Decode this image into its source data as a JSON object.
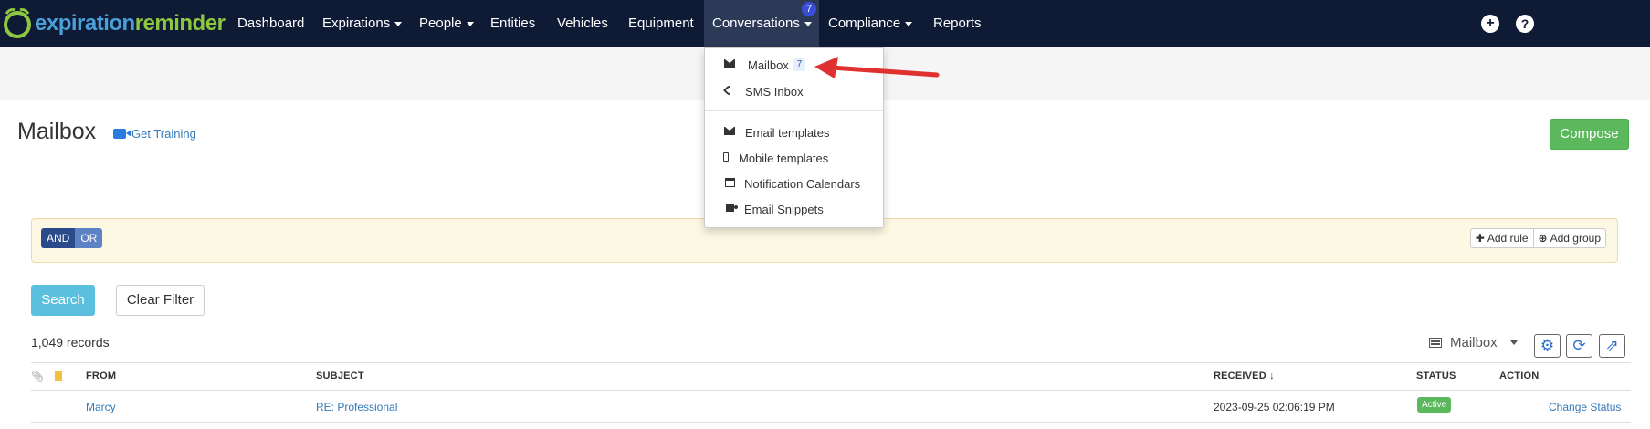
{
  "navbar": {
    "brand_part1": "expiration",
    "brand_part2": "reminder",
    "items": [
      {
        "label": "Dashboard"
      },
      {
        "label": "Expirations"
      },
      {
        "label": "People"
      },
      {
        "label": "Entities"
      },
      {
        "label": "Vehicles"
      },
      {
        "label": "Equipment"
      },
      {
        "label": "Conversations",
        "badge": "7"
      },
      {
        "label": "Compliance"
      },
      {
        "label": "Reports"
      }
    ],
    "plus_icon": "plus-circle-icon",
    "help_icon": "question-circle-icon"
  },
  "dropdown": {
    "items": [
      {
        "label": "Mailbox",
        "badge": "7",
        "icon": "envelope-icon"
      },
      {
        "label": "SMS Inbox",
        "icon": "phone-icon"
      },
      {
        "label": "Email templates",
        "icon": "envelope-icon"
      },
      {
        "label": "Mobile templates",
        "icon": "mobile-icon"
      },
      {
        "label": "Notification Calendars",
        "icon": "calendar-icon"
      },
      {
        "label": "Email Snippets",
        "icon": "puzzle-icon"
      }
    ]
  },
  "page": {
    "title": "Mailbox",
    "training_label": "Get Training",
    "compose_label": "Compose"
  },
  "query_builder": {
    "and_label": "AND",
    "or_label": "OR",
    "add_rule_label": "Add rule",
    "add_group_label": "Add group"
  },
  "filters": {
    "search_label": "Search",
    "clear_label": "Clear Filter"
  },
  "records_text": "1,049 records",
  "view_select": "Mailbox",
  "table": {
    "headers": [
      "FROM",
      "SUBJECT",
      "RECEIVED",
      "STATUS",
      "ACTION"
    ],
    "sort_indicator": "↓",
    "rows": [
      {
        "from": "Marcy",
        "subject": "RE: Professional",
        "received": "2023-09-25 02:06:19 PM",
        "status": "Active",
        "action": "Change Status"
      }
    ]
  },
  "colors": {
    "navbar_bg": "#0f1a35",
    "brand_blue": "#4aa0d8",
    "brand_green": "#8dc63f",
    "compose_green": "#5cb85c",
    "search_blue": "#5bc0de",
    "annotation_red": "#e03131"
  }
}
